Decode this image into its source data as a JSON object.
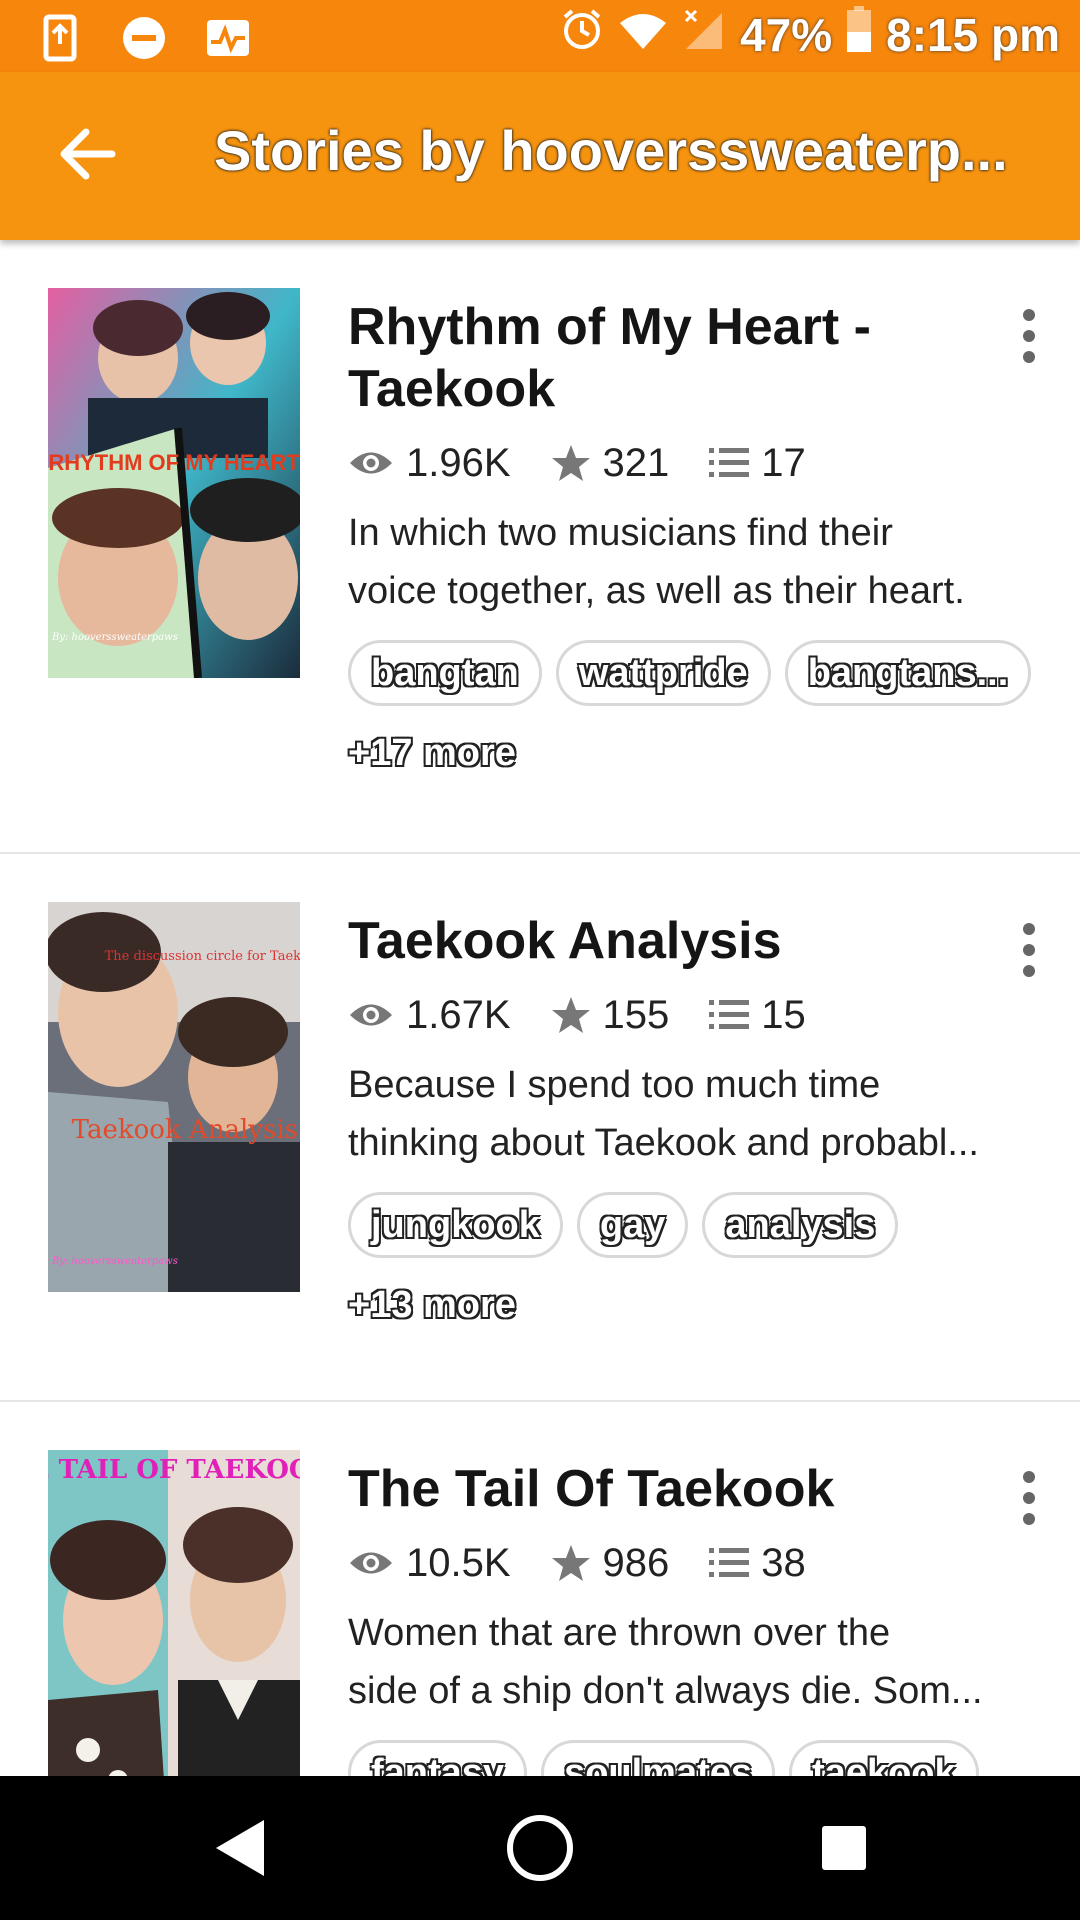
{
  "status_bar": {
    "battery": "47%",
    "time": "8:15 pm"
  },
  "app_bar": {
    "title": "Stories by hooverssweaterp..."
  },
  "stories": [
    {
      "title": "Rhythm of My Heart - Taekook",
      "reads": "1.96K",
      "votes": "321",
      "parts": "17",
      "desc_line1": "In which two musicians find their",
      "desc_line2": "voice together, as well as their heart.",
      "tags": [
        "bangtan",
        "wattpride",
        "bangtans..."
      ],
      "more": "+17 more",
      "cover_text": "RHYTHM OF MY HEART",
      "cover_byline": "By: hooverssweaterpaws"
    },
    {
      "title": "Taekook Analysis",
      "reads": "1.67K",
      "votes": "155",
      "parts": "15",
      "desc_line1": "Because I spend too much time",
      "desc_line2": "thinking about Taekook and probabl...",
      "tags": [
        "jungkook",
        "gay",
        "analysis"
      ],
      "more": "+13 more",
      "cover_text": "The discussion circle for Taekook stans",
      "cover_text2": "Taekook Analysis",
      "cover_byline": "By: hooverssweaterpaws"
    },
    {
      "title": "The Tail Of Taekook",
      "reads": "10.5K",
      "votes": "986",
      "parts": "38",
      "desc_line1": "Women that are thrown over the",
      "desc_line2": "side of a ship don't always die. Som...",
      "tags": [
        "fantasy",
        "soulmates",
        "taekook"
      ],
      "cover_text": "THE TAIL OF TAEKOOK"
    }
  ],
  "colors": {
    "status_bar": "#f7860c",
    "app_bar": "#f7940f",
    "nav_bar": "#000000"
  }
}
